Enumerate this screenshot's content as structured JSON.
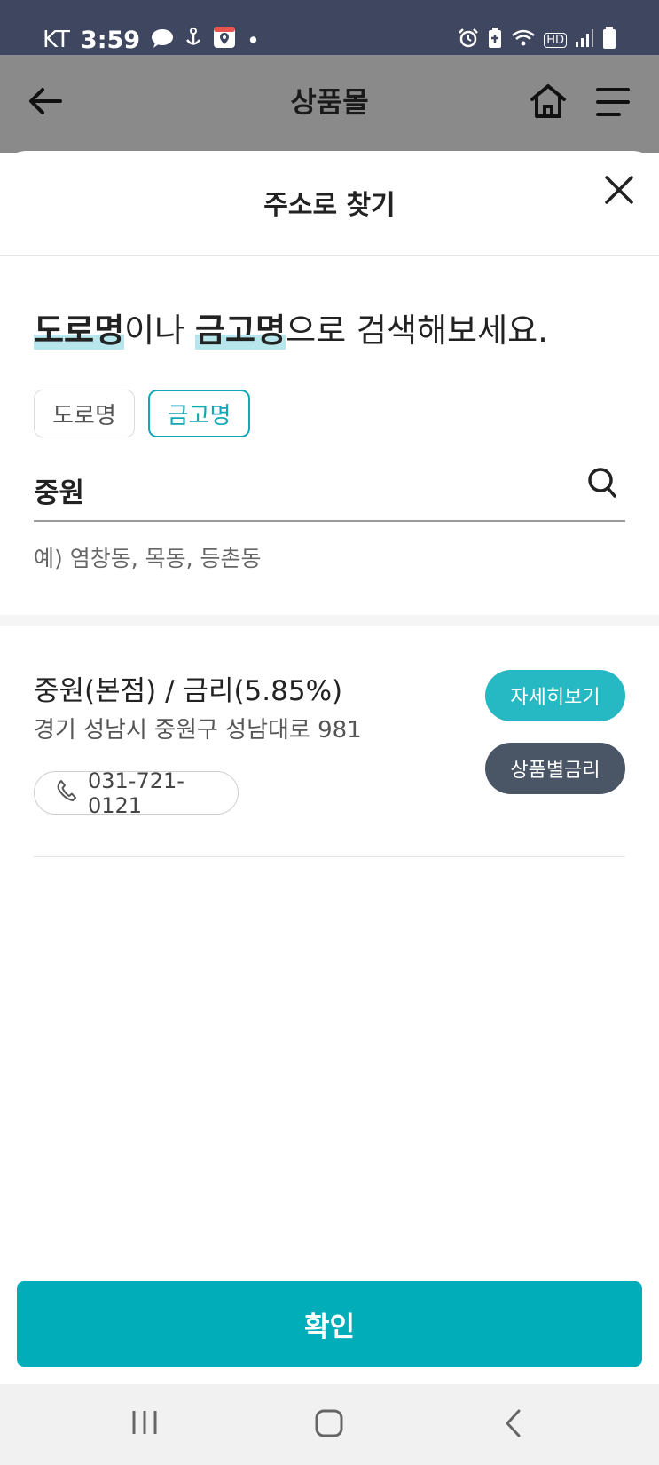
{
  "status_bar": {
    "carrier": "KT",
    "time": "3:59",
    "dot": "•",
    "left_icons": [
      "chat-bubble-icon",
      "anchor-notification-icon",
      "map-app-icon"
    ],
    "right_icons": [
      "alarm-icon",
      "battery-saver-icon",
      "wifi-icon",
      "hd-volte-icon",
      "signal-icon",
      "battery-icon"
    ],
    "hd_label": "HD"
  },
  "app_bar": {
    "title": "상품몰",
    "icons": [
      "back-arrow-icon",
      "home-icon",
      "hamburger-menu-icon"
    ]
  },
  "sheet": {
    "title": "주소로 찾기",
    "headline": {
      "highlight_1": "도로명",
      "text_1": "이나 ",
      "highlight_2": "금고명",
      "text_2": "으로 검색해보세요."
    },
    "chips": [
      {
        "label": "도로명",
        "selected": false
      },
      {
        "label": "금고명",
        "selected": true
      }
    ],
    "search": {
      "value": "중원"
    },
    "example": "예) 염창동, 목동, 등촌동"
  },
  "results": [
    {
      "name": "중원(본점) / 금리(5.85%)",
      "address": "경기 성남시 중원구 성남대로 981",
      "phone": "031-721-0121",
      "detail_button": "자세히보기",
      "rate_button": "상품별금리"
    }
  ],
  "confirm_button": "확인",
  "colors": {
    "accent": "#00adb9",
    "chip_selected": "#12a7b4",
    "detail_button": "#26b8c3",
    "rate_button": "#4a5566",
    "status_bar": "#3f4660",
    "overlay_app_bar": "#8a8a8a",
    "highlight": "#b7e6ec"
  }
}
